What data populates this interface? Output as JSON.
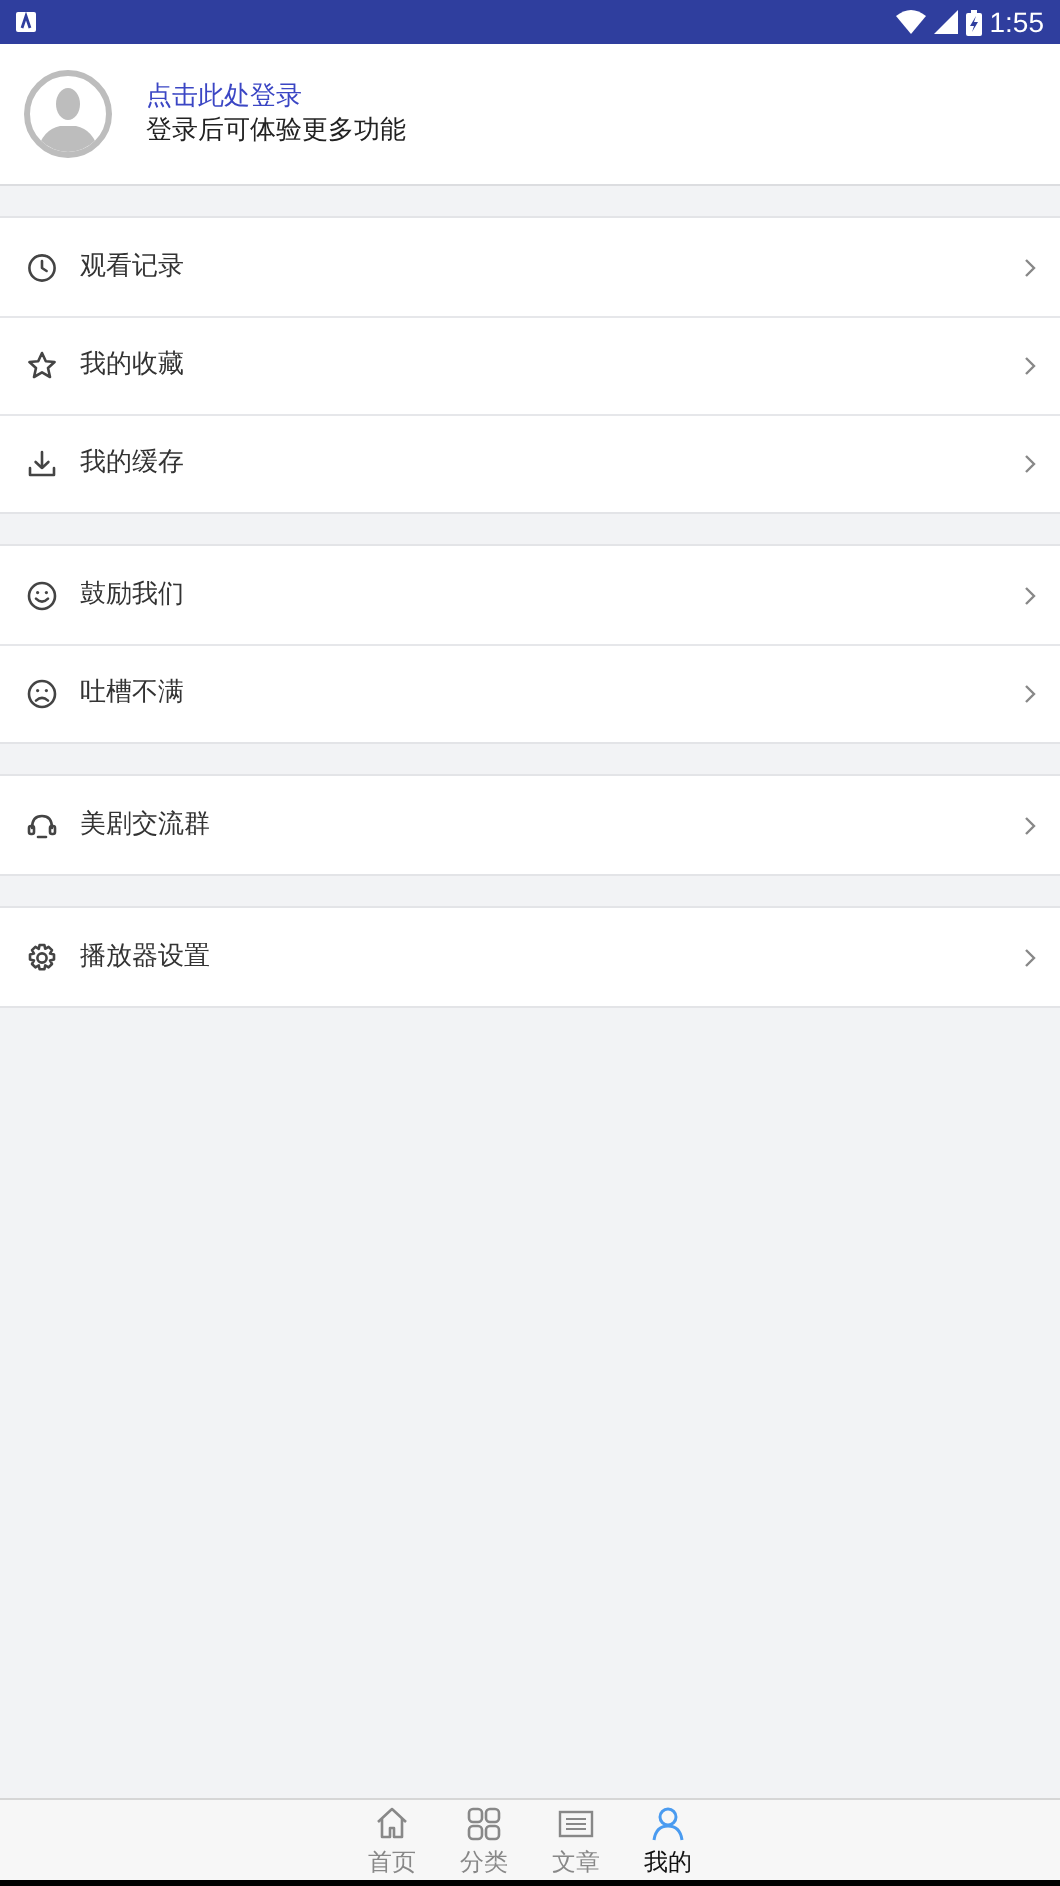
{
  "status_bar": {
    "time": "1:55"
  },
  "profile": {
    "login_link": "点击此处登录",
    "subtitle": "登录后可体验更多功能"
  },
  "menu_groups": [
    {
      "items": [
        {
          "kind": "clock",
          "label": "观看记录"
        },
        {
          "kind": "star",
          "label": "我的收藏"
        },
        {
          "kind": "download",
          "label": "我的缓存"
        }
      ]
    },
    {
      "items": [
        {
          "kind": "smile",
          "label": "鼓励我们"
        },
        {
          "kind": "frown",
          "label": "吐槽不满"
        }
      ]
    },
    {
      "items": [
        {
          "kind": "headset",
          "label": "美剧交流群"
        }
      ]
    },
    {
      "items": [
        {
          "kind": "gear",
          "label": "播放器设置"
        }
      ]
    }
  ],
  "tabs": [
    {
      "kind": "home",
      "label": "首页",
      "selected": false
    },
    {
      "kind": "grid",
      "label": "分类",
      "selected": false
    },
    {
      "kind": "article",
      "label": "文章",
      "selected": false
    },
    {
      "kind": "person",
      "label": "我的",
      "selected": true
    }
  ]
}
